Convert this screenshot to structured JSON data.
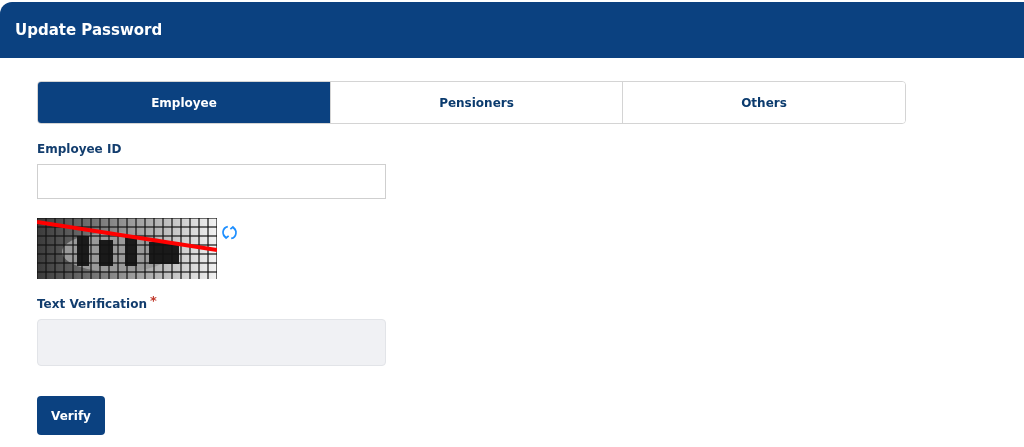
{
  "header": {
    "title": "Update Password"
  },
  "tabs": [
    {
      "label": "Employee",
      "selected": true
    },
    {
      "label": "Pensioners",
      "selected": false
    },
    {
      "label": "Others",
      "selected": false
    }
  ],
  "employee_id": {
    "label": "Employee ID"
  },
  "text_verification": {
    "label": "Text Verification",
    "required": true,
    "required_mark": "*",
    "disabled": true
  },
  "button": {
    "label": "Verify"
  }
}
